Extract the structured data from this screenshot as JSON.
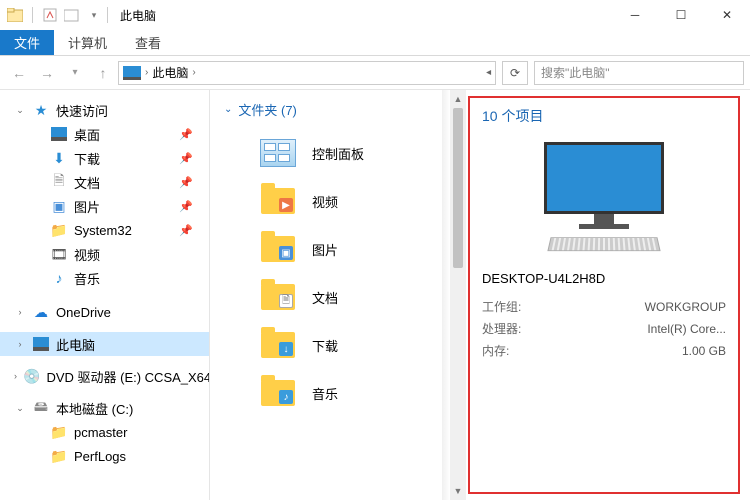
{
  "window": {
    "title": "此电脑"
  },
  "ribbon": {
    "file": "文件",
    "computer": "计算机",
    "view": "查看"
  },
  "nav": {
    "back": "←",
    "fwd": "→",
    "up": "↑",
    "refresh": "⟳"
  },
  "breadcrumb": {
    "location": "此电脑",
    "chev": "›"
  },
  "search": {
    "placeholder": "搜索\"此电脑\""
  },
  "sidebar": {
    "quickaccess": {
      "label": "快速访问",
      "expanded": true
    },
    "qa_items": [
      {
        "label": "桌面",
        "icon": "desktop"
      },
      {
        "label": "下载",
        "icon": "downloads"
      },
      {
        "label": "文档",
        "icon": "documents"
      },
      {
        "label": "图片",
        "icon": "pictures"
      },
      {
        "label": "System32",
        "icon": "folder"
      },
      {
        "label": "视频",
        "icon": "video"
      },
      {
        "label": "音乐",
        "icon": "music"
      }
    ],
    "onedrive": {
      "label": "OneDrive"
    },
    "thispc": {
      "label": "此电脑"
    },
    "dvd": {
      "label": "DVD 驱动器 (E:) CCSA_X64"
    },
    "localdisk": {
      "label": "本地磁盘 (C:)"
    },
    "cdrive_items": [
      {
        "label": "pcmaster"
      },
      {
        "label": "PerfLogs"
      }
    ]
  },
  "content": {
    "group_label": "文件夹 (7)",
    "items": [
      {
        "label": "控制面板",
        "kind": "ctrlpanel"
      },
      {
        "label": "视频",
        "kind": "video"
      },
      {
        "label": "图片",
        "kind": "pictures"
      },
      {
        "label": "文档",
        "kind": "documents"
      },
      {
        "label": "下载",
        "kind": "downloads"
      },
      {
        "label": "音乐",
        "kind": "music"
      }
    ]
  },
  "details": {
    "header": "10 个项目",
    "computer_name": "DESKTOP-U4L2H8D",
    "props": [
      {
        "k": "工作组:",
        "v": "WORKGROUP"
      },
      {
        "k": "处理器:",
        "v": "Intel(R) Core..."
      },
      {
        "k": "内存:",
        "v": "1.00 GB"
      }
    ]
  }
}
